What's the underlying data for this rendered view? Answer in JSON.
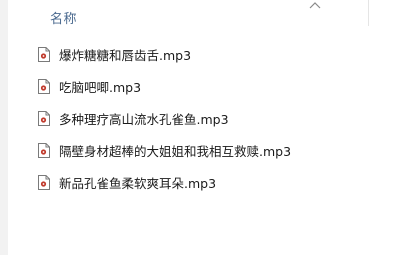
{
  "header": {
    "name_column": "名称"
  },
  "files": [
    {
      "name": "爆炸糖糖和唇齿舌.mp3",
      "icon": "audio-file-icon"
    },
    {
      "name": "吃脑吧唧.mp3",
      "icon": "audio-file-icon"
    },
    {
      "name": "多种理疗高山流水孔雀鱼.mp3",
      "icon": "audio-file-icon"
    },
    {
      "name": "隔壁身材超棒的大姐姐和我相互救赎.mp3",
      "icon": "audio-file-icon"
    },
    {
      "name": "新品孔雀鱼柔软爽耳朵.mp3",
      "icon": "audio-file-icon"
    }
  ],
  "colors": {
    "header_text": "#4b6a8f",
    "file_text": "#1a1a1a",
    "icon_accent": "#c0392b"
  }
}
